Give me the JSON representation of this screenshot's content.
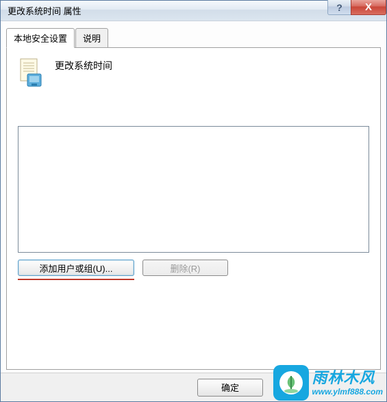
{
  "window": {
    "title": "更改系统时间 属性"
  },
  "tabs": [
    {
      "label": "本地安全设置",
      "active": true
    },
    {
      "label": "说明",
      "active": false
    }
  ],
  "policy": {
    "title": "更改系统时间"
  },
  "buttons": {
    "add_user_group": "添加用户或组(U)...",
    "remove": "删除(R)",
    "ok": "确定"
  },
  "titlebar": {
    "help_symbol": "?",
    "close_symbol": "X"
  },
  "watermark": {
    "line1": "雨林木风",
    "line2": "www.ylmf888.com"
  }
}
